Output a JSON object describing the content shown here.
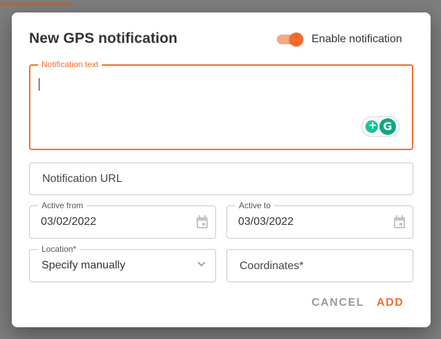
{
  "dialog": {
    "title": "New GPS notification",
    "enable_label": "Enable notification",
    "enabled": true
  },
  "fields": {
    "notification_text": {
      "label": "Notification text",
      "value": ""
    },
    "notification_url": {
      "placeholder": "Notification URL"
    },
    "active_from": {
      "label": "Active from",
      "value": "03/02/2022"
    },
    "active_to": {
      "label": "Active to",
      "value": "03/03/2022"
    },
    "location": {
      "label": "Location*",
      "value": "Specify manually"
    },
    "coordinates": {
      "placeholder": "Coordinates*"
    }
  },
  "actions": {
    "cancel_label": "CANCEL",
    "add_label": "ADD"
  },
  "grammarly": {
    "logo_letter": "G"
  },
  "colors": {
    "accent": "#f26c2c",
    "toggle_track": "#f6a882",
    "grammarly_green": "#15c39a"
  }
}
